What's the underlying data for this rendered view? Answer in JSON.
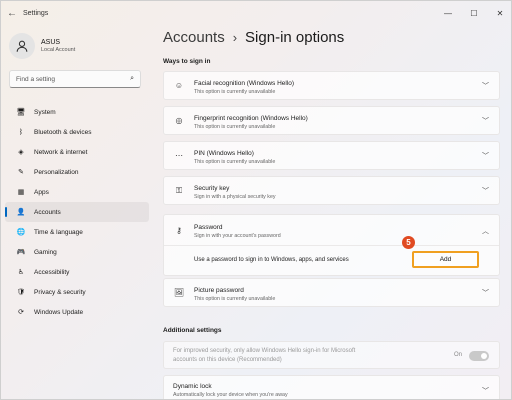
{
  "window": {
    "title": "Settings"
  },
  "controls": {
    "back": "←",
    "minimize": "—",
    "maximize": "☐",
    "close": "✕"
  },
  "profile": {
    "name": "ASUS",
    "subtitle": "Local Account"
  },
  "search": {
    "placeholder": "Find a setting"
  },
  "sidebar": {
    "items": [
      {
        "label": "System",
        "icon": "monitor-icon",
        "glyph": "🖥",
        "active": false
      },
      {
        "label": "Bluetooth & devices",
        "icon": "bluetooth-icon",
        "glyph": "ᛒ",
        "active": false
      },
      {
        "label": "Network & internet",
        "icon": "wifi-icon",
        "glyph": "◈",
        "active": false
      },
      {
        "label": "Personalization",
        "icon": "brush-icon",
        "glyph": "✎",
        "active": false
      },
      {
        "label": "Apps",
        "icon": "apps-icon",
        "glyph": "▦",
        "active": false
      },
      {
        "label": "Accounts",
        "icon": "person-icon",
        "glyph": "👤",
        "active": true
      },
      {
        "label": "Time & language",
        "icon": "globe-clock-icon",
        "glyph": "🌐",
        "active": false
      },
      {
        "label": "Gaming",
        "icon": "gamepad-icon",
        "glyph": "🎮",
        "active": false
      },
      {
        "label": "Accessibility",
        "icon": "accessibility-icon",
        "glyph": "♿",
        "active": false
      },
      {
        "label": "Privacy & security",
        "icon": "shield-icon",
        "glyph": "🛡",
        "active": false
      },
      {
        "label": "Windows Update",
        "icon": "update-icon",
        "glyph": "⟳",
        "active": false
      }
    ]
  },
  "breadcrumb": {
    "parent": "Accounts",
    "separator": "›",
    "current": "Sign-in options"
  },
  "ways": {
    "heading": "Ways to sign in",
    "options": [
      {
        "title": "Facial recognition (Windows Hello)",
        "subtitle": "This option is currently unavailable",
        "icon": "face-icon",
        "glyph": "☺"
      },
      {
        "title": "Fingerprint recognition (Windows Hello)",
        "subtitle": "This option is currently unavailable",
        "icon": "fingerprint-icon",
        "glyph": "◎"
      },
      {
        "title": "PIN (Windows Hello)",
        "subtitle": "This option is currently unavailable",
        "icon": "pin-icon",
        "glyph": "⋯"
      },
      {
        "title": "Security key",
        "subtitle": "Sign in with a physical security key",
        "icon": "key-icon",
        "glyph": "⚿"
      }
    ],
    "password": {
      "title": "Password",
      "subtitle": "Sign in with your account's password",
      "icon": "password-key-icon",
      "glyph": "⚷",
      "detail": "Use a password to sign in to Windows, apps, and services",
      "add_label": "Add",
      "step_badge": "5"
    },
    "picture": {
      "title": "Picture password",
      "subtitle": "This option is currently unavailable",
      "icon": "picture-icon",
      "glyph": "🖼"
    }
  },
  "additional": {
    "heading": "Additional settings",
    "hello_only": {
      "text_line1": "For improved security, only allow Windows Hello sign-in for Microsoft",
      "text_line2": "accounts on this device (Recommended)",
      "state": "On"
    },
    "dynamic_lock": {
      "title": "Dynamic lock",
      "subtitle": "Automatically lock your device when you're away",
      "icon": "lock-icon",
      "glyph": "🔒"
    }
  }
}
